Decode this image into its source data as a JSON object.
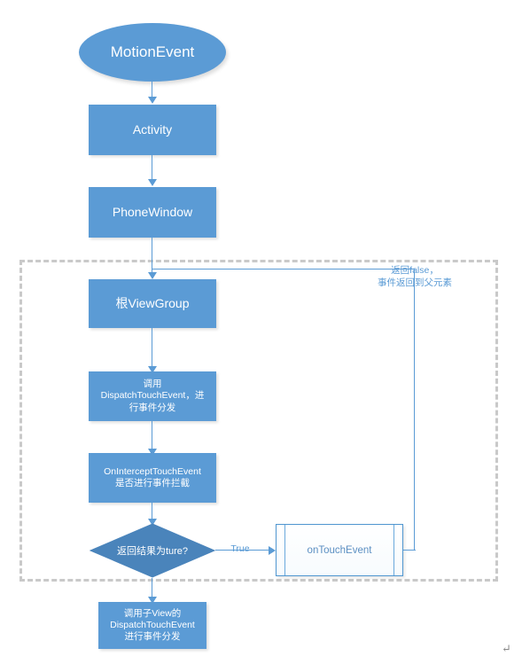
{
  "diagram": {
    "title": "Android MotionEvent dispatch flowchart",
    "colors": {
      "shape_fill": "#5B9BD5",
      "shape_text": "#FFFFFF",
      "connector": "#5B9BD5",
      "edge_label_text": "#5B9BD5",
      "dashed_region_border": "#C9C9C9",
      "predefined_process_border": "#4F96D0",
      "predefined_process_text": "#5B8FC2",
      "page_background": "#FFFFFF"
    },
    "nodes": {
      "motion_event": "MotionEvent",
      "activity": "Activity",
      "phone_window": "PhoneWindow",
      "root_viewgroup": "根ViewGroup",
      "dispatch_touch_event": "调用\nDispatchTouchEvent，进\n行事件分发",
      "on_intercept_touch_event": "OnInterceptTouchEvent\n是否进行事件拦截",
      "decision_return_true": "返回结果为ture?",
      "on_touch_event": "onTouchEvent",
      "child_dispatch": "调用子View的\nDispatchTouchEvent\n进行事件分发"
    },
    "edge_labels": {
      "true_branch": "True",
      "return_false_note": "返回false，\n事件返回到父元素"
    },
    "marks": {
      "paragraph_return": "↵"
    }
  }
}
